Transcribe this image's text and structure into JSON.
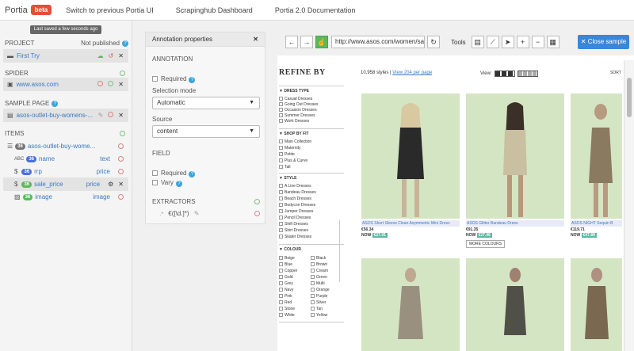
{
  "topbar": {
    "brand": "Portia",
    "badge": "beta",
    "links": [
      "Switch to previous Portia UI",
      "Scrapinghub Dashboard",
      "Portia 2.0 Documentation"
    ]
  },
  "left": {
    "saved": "Last saved a few seconds ago",
    "project_label": "PROJECT",
    "project_status": "Not published",
    "project_name": "First Try",
    "spider_label": "SPIDER",
    "spider_name": "www.asos.com",
    "sample_label": "SAMPLE PAGE",
    "sample_name": "asos-outlet-buy-womens-...",
    "items_label": "ITEMS",
    "item_root": {
      "badge": "36",
      "name": "asos-outlet-buy-wome..."
    },
    "fields": [
      {
        "prefix": "ABC",
        "badge": "36",
        "name": "name",
        "type": "text"
      },
      {
        "prefix": "$",
        "badge": "36",
        "name": "rrp",
        "type": "price"
      },
      {
        "prefix": "$",
        "badge": "36",
        "name": "sale_price",
        "type": "price"
      },
      {
        "prefix": "img",
        "badge": "36",
        "name": "image",
        "type": "image"
      }
    ]
  },
  "annotation": {
    "title": "Annotation properties",
    "section_annotation": "ANNOTATION",
    "required": "Required",
    "selection_mode_label": "Selection mode",
    "selection_mode_value": "Automatic",
    "source_label": "Source",
    "source_value": "content",
    "section_field": "FIELD",
    "field_required": "Required",
    "vary": "Vary",
    "extractors_label": "EXTRACTORS",
    "extractor_value": "€([\\d.]*)"
  },
  "browser": {
    "url": "http://www.asos.com/women/sale/",
    "tools_label": "Tools",
    "close_label": "✕ Close sample"
  },
  "page": {
    "refine": "REFINE BY",
    "styles_count": "10,958 styles |",
    "view_link": "View 204 per page",
    "view_label": "View:",
    "sort_label": "SORT",
    "dress_type": {
      "head": "DRESS TYPE",
      "items": [
        "Casual Dresses",
        "Going Out Dresses",
        "Occasion Dresses",
        "Summer Dresses",
        "Work Dresses"
      ]
    },
    "shop_by_fit": {
      "head": "SHOP BY FIT",
      "items": [
        "Main Collection",
        "Maternity",
        "Petite",
        "Plus & Curve",
        "Tall"
      ]
    },
    "style": {
      "head": "STYLE",
      "items": [
        "A Line Dresses",
        "Bandeau Dresses",
        "Beach Dresses",
        "Bodycon Dresses",
        "Jumper Dresses",
        "Pencil Dresses",
        "Shift Dresses",
        "Shirt Dresses",
        "Skater Dresses"
      ]
    },
    "colour": {
      "head": "COLOUR",
      "col1": [
        "Beige",
        "Blue",
        "Copper",
        "Gold",
        "Grey",
        "Navy",
        "Pink",
        "Red",
        "Stone",
        "White"
      ],
      "col2": [
        "Black",
        "Brown",
        "Cream",
        "Green",
        "Multi",
        "Orange",
        "Purple",
        "Silver",
        "Tan",
        "Yellow"
      ]
    },
    "products": [
      {
        "title": "ASOS Short Sleeve Clean Asymmetric Mini Dress",
        "price": "€56.34",
        "now": "NOW",
        "sale": "€27.91"
      },
      {
        "title": "ASOS Glitter Bandeau Dress",
        "price": "€91.35",
        "now": "NOW",
        "sale": "€27.46",
        "more": "MORE COLOURS"
      },
      {
        "title": "ASOS NIGHT Sequin B",
        "price": "€119.71",
        "now": "NOW",
        "sale": "€47.89"
      }
    ]
  }
}
